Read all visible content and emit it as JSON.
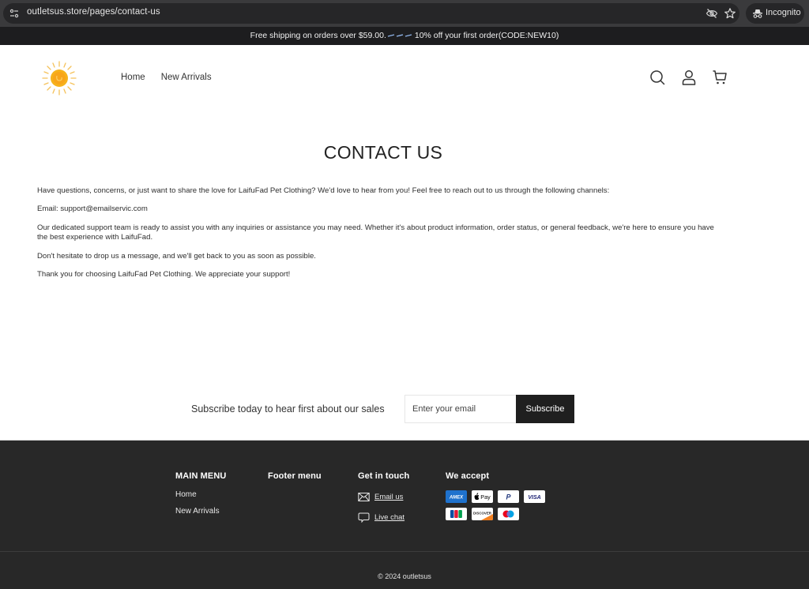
{
  "browser": {
    "url": "outletsus.store/pages/contact-us",
    "incognito_label": "Incognito",
    "icons": [
      "tune-icon",
      "eye-off-icon",
      "star-icon",
      "incognito-icon"
    ]
  },
  "announcement": {
    "text_before": "Free shipping on orders over $59.00.",
    "text_after": "10% off your first order(CODE:NEW10)"
  },
  "header": {
    "logo": "sun-logo",
    "nav": [
      {
        "label": "Home"
      },
      {
        "label": "New Arrivals"
      }
    ],
    "icons": [
      "search-icon",
      "account-icon",
      "cart-icon"
    ]
  },
  "main": {
    "title": "CONTACT US",
    "paragraphs": [
      "Have questions, concerns, or just want to share the love for LaifuFad Pet Clothing? We'd love to hear from you! Feel free to reach out to us through the following channels:",
      "Email: support@emailservic.com",
      "Our dedicated support team is ready to assist you with any inquiries or assistance you may need. Whether it's about product information, order status, or general feedback, we're here to ensure you have the best experience with LaifuFad.",
      "Don't hesitate to drop us a message, and we'll get back to you as soon as possible.",
      "Thank you for choosing LaifuFad Pet Clothing. We appreciate your support!"
    ]
  },
  "newsletter": {
    "label": "Subscribe today to hear first about our sales",
    "placeholder": "Enter your email",
    "value": "",
    "button": "Subscribe"
  },
  "footer": {
    "main_menu": {
      "heading": "MAIN MENU",
      "links": [
        {
          "label": "Home"
        },
        {
          "label": "New Arrivals"
        }
      ]
    },
    "footer_menu": {
      "heading": "Footer menu"
    },
    "get_in_touch": {
      "heading": "Get in touch",
      "links": [
        {
          "label": "Email us",
          "icon": "envelope-icon"
        },
        {
          "label": "Live chat",
          "icon": "chat-bubble-icon"
        }
      ]
    },
    "we_accept": {
      "heading": "We accept",
      "cards": [
        "AMEX",
        "Apple Pay",
        "PayPal",
        "VISA",
        "JCB",
        "DISCOVER",
        "Maestro"
      ]
    },
    "copyright": "© 2024 outletsus"
  },
  "colors": {
    "chrome_bg": "#3a3a3c",
    "announcement_bg": "#1d1d1f",
    "footer_bg": "#282828",
    "button_bg": "#1f1f1f",
    "sun_yellow": "#f6b21b",
    "amex_blue": "#1f72cd",
    "visa_blue": "#1a1f71"
  }
}
